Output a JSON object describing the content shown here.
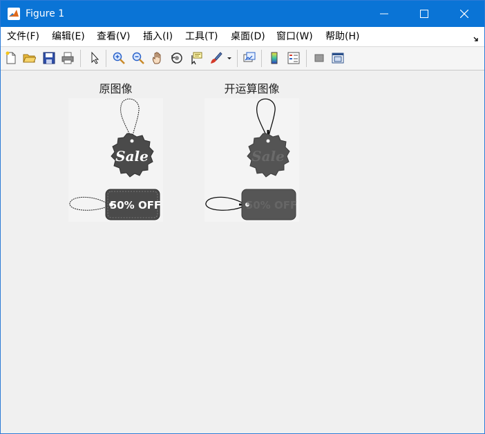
{
  "window": {
    "title": "Figure 1"
  },
  "menubar": {
    "items": [
      {
        "label": "文件(F)"
      },
      {
        "label": "编辑(E)"
      },
      {
        "label": "查看(V)"
      },
      {
        "label": "插入(I)"
      },
      {
        "label": "工具(T)"
      },
      {
        "label": "桌面(D)"
      },
      {
        "label": "窗口(W)"
      },
      {
        "label": "帮助(H)"
      }
    ]
  },
  "toolbar": {
    "icons": [
      "new-figure-icon",
      "open-file-icon",
      "save-icon",
      "print-icon",
      "pointer-icon",
      "zoom-in-icon",
      "zoom-out-icon",
      "pan-hand-icon",
      "rotate-3d-icon",
      "data-cursor-icon",
      "brush-icon",
      "brush-dropdown-icon",
      "link-plot-icon",
      "colorbar-icon",
      "legend-icon",
      "hide-plot-tools-icon",
      "show-plot-tools-icon"
    ]
  },
  "figure": {
    "subplots": [
      {
        "title": "原图像",
        "sale_tag_text": "Sale",
        "price_tag_text": "50% OFF"
      },
      {
        "title": "开运算图像",
        "sale_tag_text": "Sale",
        "price_tag_text": "50% OFF"
      }
    ]
  },
  "colors": {
    "titlebar": "#0a74d6",
    "tag_dark": "#4a4a4a",
    "canvas": "#f0f0f0"
  }
}
